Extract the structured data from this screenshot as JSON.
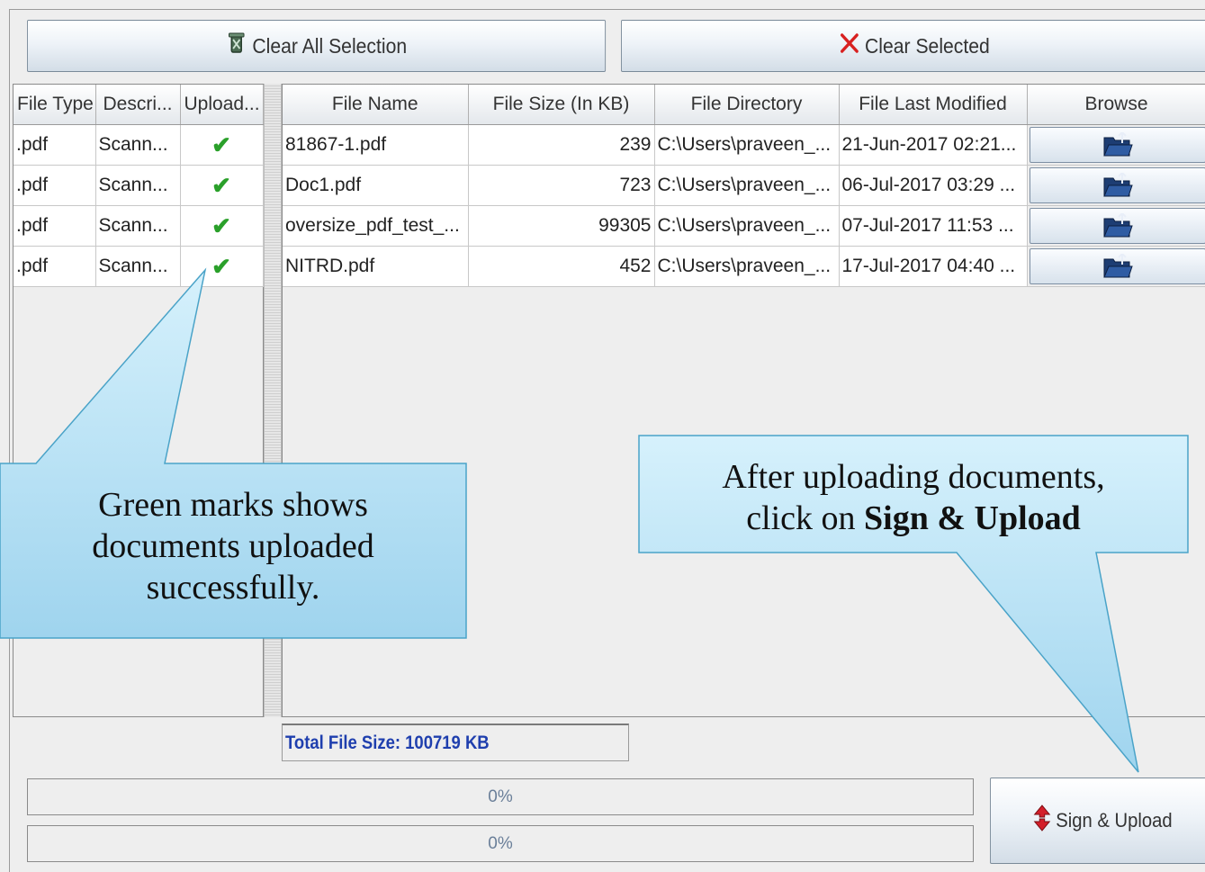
{
  "toolbar": {
    "clear_all_label": "Clear All Selection",
    "clear_selected_label": "Clear Selected"
  },
  "left_table": {
    "headers": [
      "File Type",
      "Descri...",
      "Upload..."
    ],
    "rows": [
      {
        "type": ".pdf",
        "description": "Scann...",
        "uploaded": true
      },
      {
        "type": ".pdf",
        "description": "Scann...",
        "uploaded": true
      },
      {
        "type": ".pdf",
        "description": "Scann...",
        "uploaded": true
      },
      {
        "type": ".pdf",
        "description": "Scann...",
        "uploaded": true
      }
    ]
  },
  "right_table": {
    "headers": [
      "File Name",
      "File Size (In KB)",
      "File Directory",
      "File Last Modified",
      "Browse"
    ],
    "rows": [
      {
        "name": "81867-1.pdf",
        "size": "239",
        "directory": "C:\\Users\\praveen_...",
        "modified": "21-Jun-2017 02:21..."
      },
      {
        "name": "Doc1.pdf",
        "size": "723",
        "directory": "C:\\Users\\praveen_...",
        "modified": "06-Jul-2017 03:29 ..."
      },
      {
        "name": "oversize_pdf_test_...",
        "size": "99305",
        "directory": "C:\\Users\\praveen_...",
        "modified": "07-Jul-2017 11:53 ..."
      },
      {
        "name": "NITRD.pdf",
        "size": "452",
        "directory": "C:\\Users\\praveen_...",
        "modified": "17-Jul-2017 04:40 ..."
      }
    ]
  },
  "total_file_size": "Total File Size: 100719 KB",
  "progress": [
    {
      "label": "0%",
      "value": 0
    },
    {
      "label": "0%",
      "value": 0
    }
  ],
  "sign_upload_label": "Sign & Upload",
  "callouts": {
    "left_lines": [
      "Green marks shows",
      "documents uploaded",
      "successfully."
    ],
    "right_line1": "After uploading documents,",
    "right_line2_prefix": "click on ",
    "right_line2_bold": "Sign & Upload"
  },
  "colors": {
    "check": "#2aa02a",
    "total_text": "#1f3fae",
    "callout_fill": "#bfe6f7",
    "callout_border": "#4aa3c8",
    "clear_icon": "#d82020"
  },
  "icons": {
    "clear_all": "eraser-icon",
    "clear_selected": "x-icon",
    "browse": "folder-open-icon",
    "sign_upload": "upload-arrows-icon",
    "uploaded": "checkmark-icon"
  }
}
